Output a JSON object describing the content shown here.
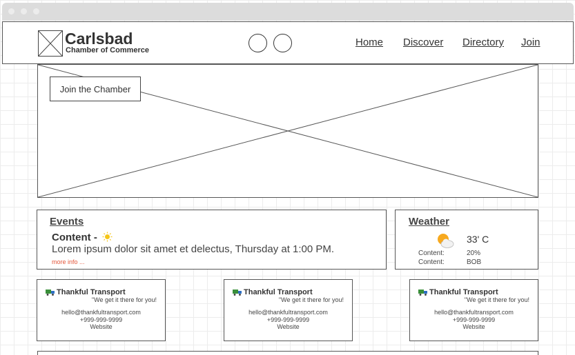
{
  "header": {
    "brand_title": "Carlsbad",
    "brand_subtitle": "Chamber of Commerce",
    "nav": [
      "Home",
      "Discover",
      "Directory",
      "Join"
    ]
  },
  "hero": {
    "button_label": "Join the Chamber"
  },
  "events": {
    "title": "Events",
    "heading": "Content -",
    "body": "Lorem ipsum dolor sit amet et delectus, Thursday at 1:00 PM.",
    "more": "more info ..."
  },
  "weather": {
    "title": "Weather",
    "temperature": "33' C",
    "rows": [
      {
        "label": "Content:",
        "value": "20%"
      },
      {
        "label": "Content:",
        "value": "BOB"
      }
    ]
  },
  "cards": [
    {
      "name": "Thankful Transport",
      "tagline": "\"We get it there for you!",
      "email": "hello@thankfultransport.com",
      "phone": "+999-999-9999",
      "website": "Website"
    },
    {
      "name": "Thankful Transport",
      "tagline": "\"We get it there for you!",
      "email": "hello@thankfultransport.com",
      "phone": "+999-999-9999",
      "website": "Website"
    },
    {
      "name": "Thankful Transport",
      "tagline": "\"We get it there for you!",
      "email": "hello@thankfultransport.com",
      "phone": "+999-999-9999",
      "website": "Website"
    }
  ],
  "icons": {
    "logo": "logo-placeholder-icon",
    "hero": "image-placeholder-icon",
    "events": "sun-icon",
    "weather": "partly-cloudy-icon",
    "card": "truck-icon"
  },
  "colors": {
    "link_accent": "#e3563a",
    "sun": "#f5c518",
    "weather_sun": "#f7a91f"
  }
}
